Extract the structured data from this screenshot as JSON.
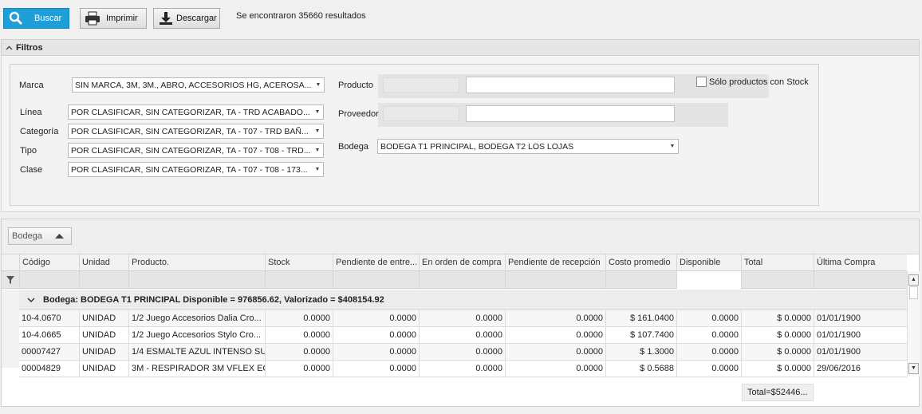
{
  "toolbar": {
    "buscar": "Buscar",
    "imprimir": "Imprimir",
    "descargar": "Descargar",
    "result_message": "Se encontraron 35660 resultados"
  },
  "filters": {
    "title": "Filtros",
    "marca_label": "Marca",
    "marca_value": "SIN MARCA, 3M, 3M., ABRO, ACCESORIOS HG, ACEROSA...",
    "linea_label": "Línea",
    "linea_value": "POR CLASIFICAR, SIN CATEGORIZAR, TA - TRD ACABADO...",
    "categoria_label": "Categoría",
    "categoria_value": "POR CLASIFICAR, SIN CATEGORIZAR, TA - T07 - TRD BAÑ...",
    "tipo_label": "Tipo",
    "tipo_value": "POR CLASIFICAR, SIN CATEGORIZAR, TA - T07 - T08 - TRD...",
    "clase_label": "Clase",
    "clase_value": "POR CLASIFICAR, SIN CATEGORIZAR, TA - T07 - T08 - 173...",
    "producto_label": "Producto",
    "producto_value": "",
    "proveedor_label": "Proveedor",
    "proveedor_value": "",
    "bodega_label": "Bodega",
    "bodega_value": "BODEGA T1  PRINCIPAL, BODEGA T2  LOS LOJAS",
    "stock_only_label": "Sólo productos con Stock"
  },
  "grid": {
    "group_chip": "Bodega",
    "columns": [
      "Código",
      "Unidad",
      "Producto.",
      "Stock",
      "Pendiente de entre...",
      "En orden de compra",
      "Pendiente de recepción",
      "Costo promedio",
      "Disponible",
      "Total",
      "Última Compra"
    ],
    "group_header": "Bodega: BODEGA T1  PRINCIPAL Disponible = 976856.62, Valorizado = $408154.92",
    "rows": [
      [
        "10-4.0670",
        "UNIDAD",
        "1/2 Juego Accesorios Dalia Cro...",
        "0.0000",
        "0.0000",
        "0.0000",
        "0.0000",
        "$ 161.0400",
        "0.0000",
        "$ 0.0000",
        "01/01/1900"
      ],
      [
        "10-4.0665",
        "UNIDAD",
        "1/2 Juego Accesorios Stylo Cro...",
        "0.0000",
        "0.0000",
        "0.0000",
        "0.0000",
        "$ 107.7400",
        "0.0000",
        "$ 0.0000",
        "01/01/1900"
      ],
      [
        "00007427",
        "UNIDAD",
        "1/4 ESMALTE AZUL INTENSO SU...",
        "0.0000",
        "0.0000",
        "0.0000",
        "0.0000",
        "$ 1.3000",
        "0.0000",
        "$ 0.0000",
        "01/01/1900"
      ],
      [
        "00004829",
        "UNIDAD",
        "3M - RESPIRADOR 3M VFLEX EC...",
        "0.0000",
        "0.0000",
        "0.0000",
        "0.0000",
        "$ 0.5688",
        "0.0000",
        "$ 0.0000",
        "29/06/2016"
      ]
    ],
    "total": "Total=$52446..."
  },
  "colors": {
    "primary": "#1e9fd8"
  }
}
